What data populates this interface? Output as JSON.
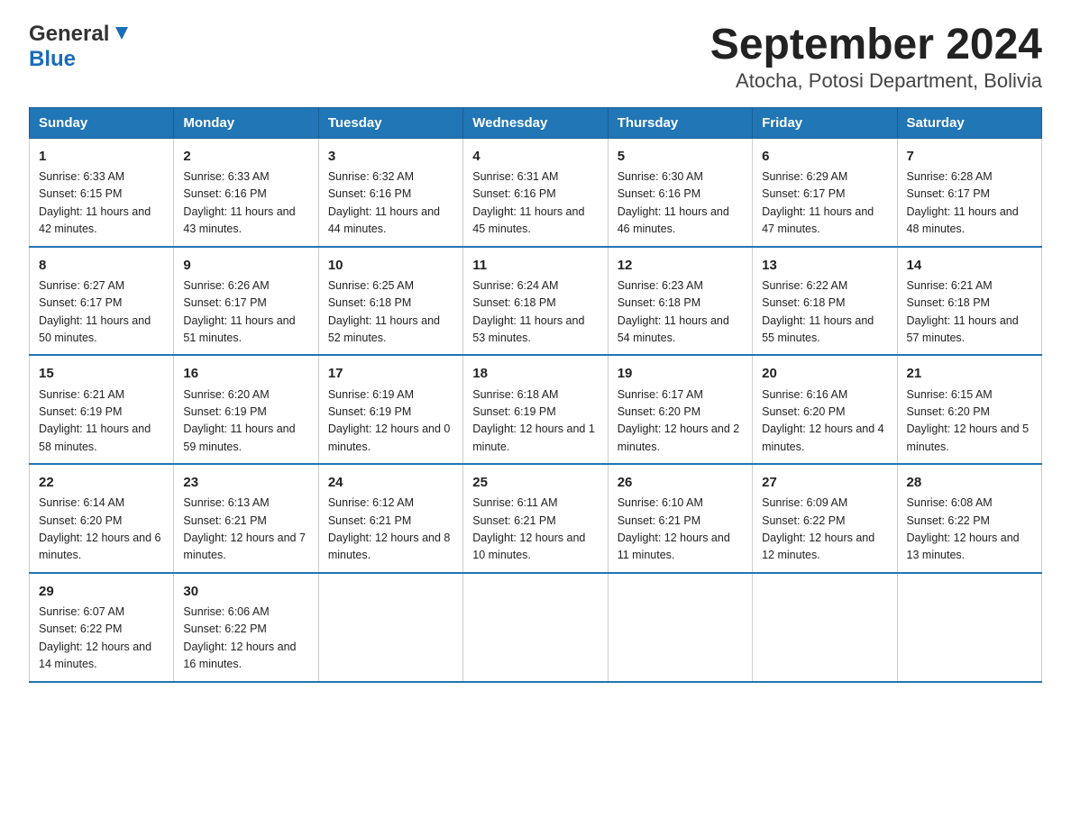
{
  "logo": {
    "line1": "General",
    "line2": "Blue"
  },
  "title": "September 2024",
  "subtitle": "Atocha, Potosi Department, Bolivia",
  "days_of_week": [
    "Sunday",
    "Monday",
    "Tuesday",
    "Wednesday",
    "Thursday",
    "Friday",
    "Saturday"
  ],
  "weeks": [
    [
      {
        "day": "1",
        "sunrise": "Sunrise: 6:33 AM",
        "sunset": "Sunset: 6:15 PM",
        "daylight": "Daylight: 11 hours and 42 minutes."
      },
      {
        "day": "2",
        "sunrise": "Sunrise: 6:33 AM",
        "sunset": "Sunset: 6:16 PM",
        "daylight": "Daylight: 11 hours and 43 minutes."
      },
      {
        "day": "3",
        "sunrise": "Sunrise: 6:32 AM",
        "sunset": "Sunset: 6:16 PM",
        "daylight": "Daylight: 11 hours and 44 minutes."
      },
      {
        "day": "4",
        "sunrise": "Sunrise: 6:31 AM",
        "sunset": "Sunset: 6:16 PM",
        "daylight": "Daylight: 11 hours and 45 minutes."
      },
      {
        "day": "5",
        "sunrise": "Sunrise: 6:30 AM",
        "sunset": "Sunset: 6:16 PM",
        "daylight": "Daylight: 11 hours and 46 minutes."
      },
      {
        "day": "6",
        "sunrise": "Sunrise: 6:29 AM",
        "sunset": "Sunset: 6:17 PM",
        "daylight": "Daylight: 11 hours and 47 minutes."
      },
      {
        "day": "7",
        "sunrise": "Sunrise: 6:28 AM",
        "sunset": "Sunset: 6:17 PM",
        "daylight": "Daylight: 11 hours and 48 minutes."
      }
    ],
    [
      {
        "day": "8",
        "sunrise": "Sunrise: 6:27 AM",
        "sunset": "Sunset: 6:17 PM",
        "daylight": "Daylight: 11 hours and 50 minutes."
      },
      {
        "day": "9",
        "sunrise": "Sunrise: 6:26 AM",
        "sunset": "Sunset: 6:17 PM",
        "daylight": "Daylight: 11 hours and 51 minutes."
      },
      {
        "day": "10",
        "sunrise": "Sunrise: 6:25 AM",
        "sunset": "Sunset: 6:18 PM",
        "daylight": "Daylight: 11 hours and 52 minutes."
      },
      {
        "day": "11",
        "sunrise": "Sunrise: 6:24 AM",
        "sunset": "Sunset: 6:18 PM",
        "daylight": "Daylight: 11 hours and 53 minutes."
      },
      {
        "day": "12",
        "sunrise": "Sunrise: 6:23 AM",
        "sunset": "Sunset: 6:18 PM",
        "daylight": "Daylight: 11 hours and 54 minutes."
      },
      {
        "day": "13",
        "sunrise": "Sunrise: 6:22 AM",
        "sunset": "Sunset: 6:18 PM",
        "daylight": "Daylight: 11 hours and 55 minutes."
      },
      {
        "day": "14",
        "sunrise": "Sunrise: 6:21 AM",
        "sunset": "Sunset: 6:18 PM",
        "daylight": "Daylight: 11 hours and 57 minutes."
      }
    ],
    [
      {
        "day": "15",
        "sunrise": "Sunrise: 6:21 AM",
        "sunset": "Sunset: 6:19 PM",
        "daylight": "Daylight: 11 hours and 58 minutes."
      },
      {
        "day": "16",
        "sunrise": "Sunrise: 6:20 AM",
        "sunset": "Sunset: 6:19 PM",
        "daylight": "Daylight: 11 hours and 59 minutes."
      },
      {
        "day": "17",
        "sunrise": "Sunrise: 6:19 AM",
        "sunset": "Sunset: 6:19 PM",
        "daylight": "Daylight: 12 hours and 0 minutes."
      },
      {
        "day": "18",
        "sunrise": "Sunrise: 6:18 AM",
        "sunset": "Sunset: 6:19 PM",
        "daylight": "Daylight: 12 hours and 1 minute."
      },
      {
        "day": "19",
        "sunrise": "Sunrise: 6:17 AM",
        "sunset": "Sunset: 6:20 PM",
        "daylight": "Daylight: 12 hours and 2 minutes."
      },
      {
        "day": "20",
        "sunrise": "Sunrise: 6:16 AM",
        "sunset": "Sunset: 6:20 PM",
        "daylight": "Daylight: 12 hours and 4 minutes."
      },
      {
        "day": "21",
        "sunrise": "Sunrise: 6:15 AM",
        "sunset": "Sunset: 6:20 PM",
        "daylight": "Daylight: 12 hours and 5 minutes."
      }
    ],
    [
      {
        "day": "22",
        "sunrise": "Sunrise: 6:14 AM",
        "sunset": "Sunset: 6:20 PM",
        "daylight": "Daylight: 12 hours and 6 minutes."
      },
      {
        "day": "23",
        "sunrise": "Sunrise: 6:13 AM",
        "sunset": "Sunset: 6:21 PM",
        "daylight": "Daylight: 12 hours and 7 minutes."
      },
      {
        "day": "24",
        "sunrise": "Sunrise: 6:12 AM",
        "sunset": "Sunset: 6:21 PM",
        "daylight": "Daylight: 12 hours and 8 minutes."
      },
      {
        "day": "25",
        "sunrise": "Sunrise: 6:11 AM",
        "sunset": "Sunset: 6:21 PM",
        "daylight": "Daylight: 12 hours and 10 minutes."
      },
      {
        "day": "26",
        "sunrise": "Sunrise: 6:10 AM",
        "sunset": "Sunset: 6:21 PM",
        "daylight": "Daylight: 12 hours and 11 minutes."
      },
      {
        "day": "27",
        "sunrise": "Sunrise: 6:09 AM",
        "sunset": "Sunset: 6:22 PM",
        "daylight": "Daylight: 12 hours and 12 minutes."
      },
      {
        "day": "28",
        "sunrise": "Sunrise: 6:08 AM",
        "sunset": "Sunset: 6:22 PM",
        "daylight": "Daylight: 12 hours and 13 minutes."
      }
    ],
    [
      {
        "day": "29",
        "sunrise": "Sunrise: 6:07 AM",
        "sunset": "Sunset: 6:22 PM",
        "daylight": "Daylight: 12 hours and 14 minutes."
      },
      {
        "day": "30",
        "sunrise": "Sunrise: 6:06 AM",
        "sunset": "Sunset: 6:22 PM",
        "daylight": "Daylight: 12 hours and 16 minutes."
      },
      null,
      null,
      null,
      null,
      null
    ]
  ]
}
